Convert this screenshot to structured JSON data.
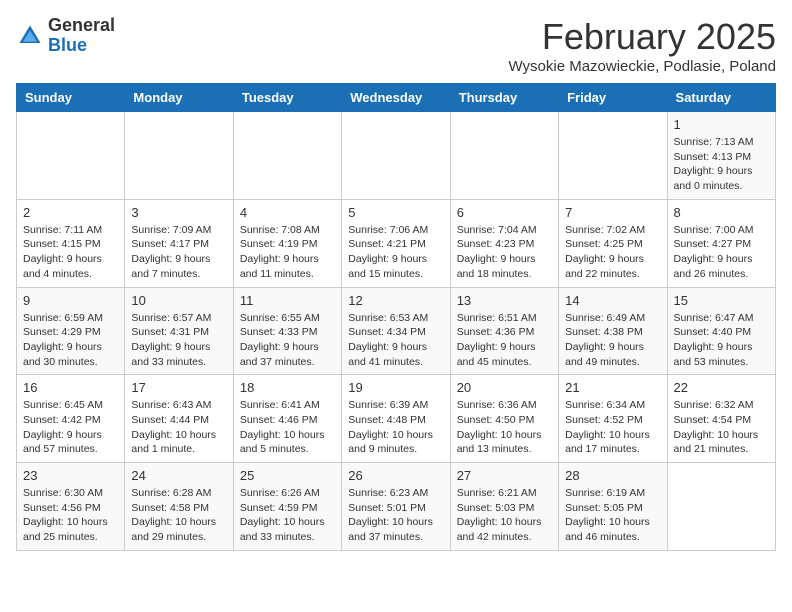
{
  "logo": {
    "general": "General",
    "blue": "Blue"
  },
  "title": {
    "month_year": "February 2025",
    "location": "Wysokie Mazowieckie, Podlasie, Poland"
  },
  "days_of_week": [
    "Sunday",
    "Monday",
    "Tuesday",
    "Wednesday",
    "Thursday",
    "Friday",
    "Saturday"
  ],
  "weeks": [
    {
      "days": [
        {
          "number": "",
          "info": ""
        },
        {
          "number": "",
          "info": ""
        },
        {
          "number": "",
          "info": ""
        },
        {
          "number": "",
          "info": ""
        },
        {
          "number": "",
          "info": ""
        },
        {
          "number": "",
          "info": ""
        },
        {
          "number": "1",
          "info": "Sunrise: 7:13 AM\nSunset: 4:13 PM\nDaylight: 9 hours and 0 minutes."
        }
      ]
    },
    {
      "days": [
        {
          "number": "2",
          "info": "Sunrise: 7:11 AM\nSunset: 4:15 PM\nDaylight: 9 hours and 4 minutes."
        },
        {
          "number": "3",
          "info": "Sunrise: 7:09 AM\nSunset: 4:17 PM\nDaylight: 9 hours and 7 minutes."
        },
        {
          "number": "4",
          "info": "Sunrise: 7:08 AM\nSunset: 4:19 PM\nDaylight: 9 hours and 11 minutes."
        },
        {
          "number": "5",
          "info": "Sunrise: 7:06 AM\nSunset: 4:21 PM\nDaylight: 9 hours and 15 minutes."
        },
        {
          "number": "6",
          "info": "Sunrise: 7:04 AM\nSunset: 4:23 PM\nDaylight: 9 hours and 18 minutes."
        },
        {
          "number": "7",
          "info": "Sunrise: 7:02 AM\nSunset: 4:25 PM\nDaylight: 9 hours and 22 minutes."
        },
        {
          "number": "8",
          "info": "Sunrise: 7:00 AM\nSunset: 4:27 PM\nDaylight: 9 hours and 26 minutes."
        }
      ]
    },
    {
      "days": [
        {
          "number": "9",
          "info": "Sunrise: 6:59 AM\nSunset: 4:29 PM\nDaylight: 9 hours and 30 minutes."
        },
        {
          "number": "10",
          "info": "Sunrise: 6:57 AM\nSunset: 4:31 PM\nDaylight: 9 hours and 33 minutes."
        },
        {
          "number": "11",
          "info": "Sunrise: 6:55 AM\nSunset: 4:33 PM\nDaylight: 9 hours and 37 minutes."
        },
        {
          "number": "12",
          "info": "Sunrise: 6:53 AM\nSunset: 4:34 PM\nDaylight: 9 hours and 41 minutes."
        },
        {
          "number": "13",
          "info": "Sunrise: 6:51 AM\nSunset: 4:36 PM\nDaylight: 9 hours and 45 minutes."
        },
        {
          "number": "14",
          "info": "Sunrise: 6:49 AM\nSunset: 4:38 PM\nDaylight: 9 hours and 49 minutes."
        },
        {
          "number": "15",
          "info": "Sunrise: 6:47 AM\nSunset: 4:40 PM\nDaylight: 9 hours and 53 minutes."
        }
      ]
    },
    {
      "days": [
        {
          "number": "16",
          "info": "Sunrise: 6:45 AM\nSunset: 4:42 PM\nDaylight: 9 hours and 57 minutes."
        },
        {
          "number": "17",
          "info": "Sunrise: 6:43 AM\nSunset: 4:44 PM\nDaylight: 10 hours and 1 minute."
        },
        {
          "number": "18",
          "info": "Sunrise: 6:41 AM\nSunset: 4:46 PM\nDaylight: 10 hours and 5 minutes."
        },
        {
          "number": "19",
          "info": "Sunrise: 6:39 AM\nSunset: 4:48 PM\nDaylight: 10 hours and 9 minutes."
        },
        {
          "number": "20",
          "info": "Sunrise: 6:36 AM\nSunset: 4:50 PM\nDaylight: 10 hours and 13 minutes."
        },
        {
          "number": "21",
          "info": "Sunrise: 6:34 AM\nSunset: 4:52 PM\nDaylight: 10 hours and 17 minutes."
        },
        {
          "number": "22",
          "info": "Sunrise: 6:32 AM\nSunset: 4:54 PM\nDaylight: 10 hours and 21 minutes."
        }
      ]
    },
    {
      "days": [
        {
          "number": "23",
          "info": "Sunrise: 6:30 AM\nSunset: 4:56 PM\nDaylight: 10 hours and 25 minutes."
        },
        {
          "number": "24",
          "info": "Sunrise: 6:28 AM\nSunset: 4:58 PM\nDaylight: 10 hours and 29 minutes."
        },
        {
          "number": "25",
          "info": "Sunrise: 6:26 AM\nSunset: 4:59 PM\nDaylight: 10 hours and 33 minutes."
        },
        {
          "number": "26",
          "info": "Sunrise: 6:23 AM\nSunset: 5:01 PM\nDaylight: 10 hours and 37 minutes."
        },
        {
          "number": "27",
          "info": "Sunrise: 6:21 AM\nSunset: 5:03 PM\nDaylight: 10 hours and 42 minutes."
        },
        {
          "number": "28",
          "info": "Sunrise: 6:19 AM\nSunset: 5:05 PM\nDaylight: 10 hours and 46 minutes."
        },
        {
          "number": "",
          "info": ""
        }
      ]
    }
  ]
}
